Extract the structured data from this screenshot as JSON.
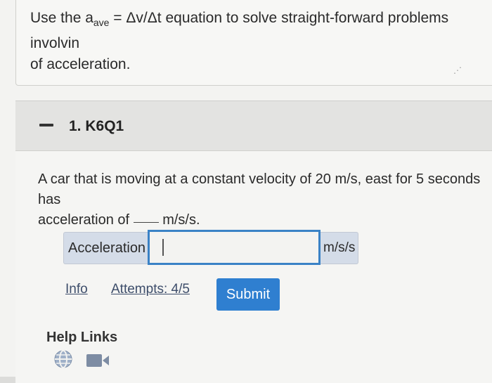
{
  "objective": {
    "prefix": "Use the a",
    "subscript": "ave",
    "suffix": " = Δv/Δt equation to solve straight-forward problems involvin",
    "line2": "of acceleration."
  },
  "question": {
    "title": "1. K6Q1",
    "text_before_blank": "A car that is moving at a constant velocity of 20 m/s, east for 5 seconds has",
    "line2_prefix": "acceleration of ",
    "line2_suffix": " m/s/s."
  },
  "answer": {
    "label": "Acceleration",
    "value": "",
    "unit": "m/s/s"
  },
  "actions": {
    "info_label": "Info",
    "attempts_label": "Attempts: 4/5",
    "submit_label": "Submit"
  },
  "help": {
    "title": "Help Links",
    "icons": [
      "globe-icon",
      "video-camera-icon"
    ]
  },
  "colors": {
    "accent": "#2f7fd0",
    "input_border": "#3a82c6",
    "label_bg": "#d4dce8"
  }
}
